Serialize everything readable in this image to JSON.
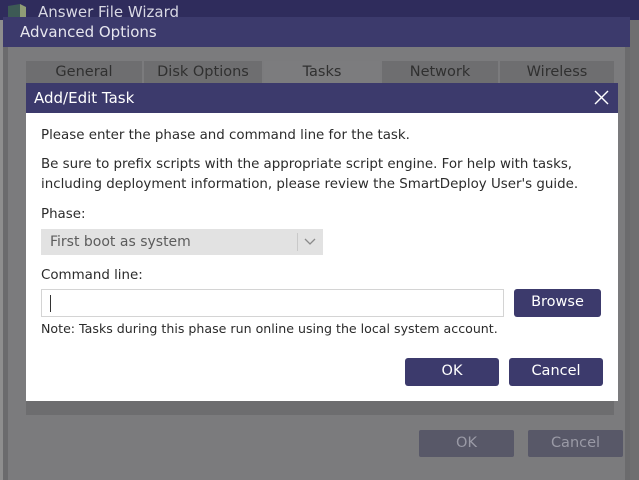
{
  "wizard": {
    "title": "Answer File Wizard",
    "icon": "app-icon"
  },
  "advanced_options": {
    "title": "Advanced Options",
    "tabs": [
      {
        "label": "General",
        "selected": false
      },
      {
        "label": "Disk Options",
        "selected": false
      },
      {
        "label": "Tasks",
        "selected": true
      },
      {
        "label": "Network",
        "selected": false
      },
      {
        "label": "Wireless",
        "selected": false
      }
    ],
    "ok_label": "OK",
    "cancel_label": "Cancel"
  },
  "dialog": {
    "title": "Add/Edit Task",
    "close_icon": "close-icon",
    "intro": "Please enter the phase and command line for the task.",
    "help_line1": "Be sure to prefix scripts with the appropriate script engine. For help with tasks,",
    "help_line2": "including deployment information, please review the SmartDeploy User's guide.",
    "phase_label": "Phase:",
    "phase_value": "First boot as system",
    "command_label": "Command line:",
    "command_value": "",
    "browse_label": "Browse",
    "note": "Note: Tasks during this phase run online using the local system account.",
    "ok_label": "OK",
    "cancel_label": "Cancel"
  },
  "colors": {
    "title_bar": "#3c3a6c",
    "dialog_bg": "#ffffff",
    "select_bg": "#e2e2e2",
    "button_bg": "#3c3a6c",
    "overlay": "#7b7b7d"
  }
}
